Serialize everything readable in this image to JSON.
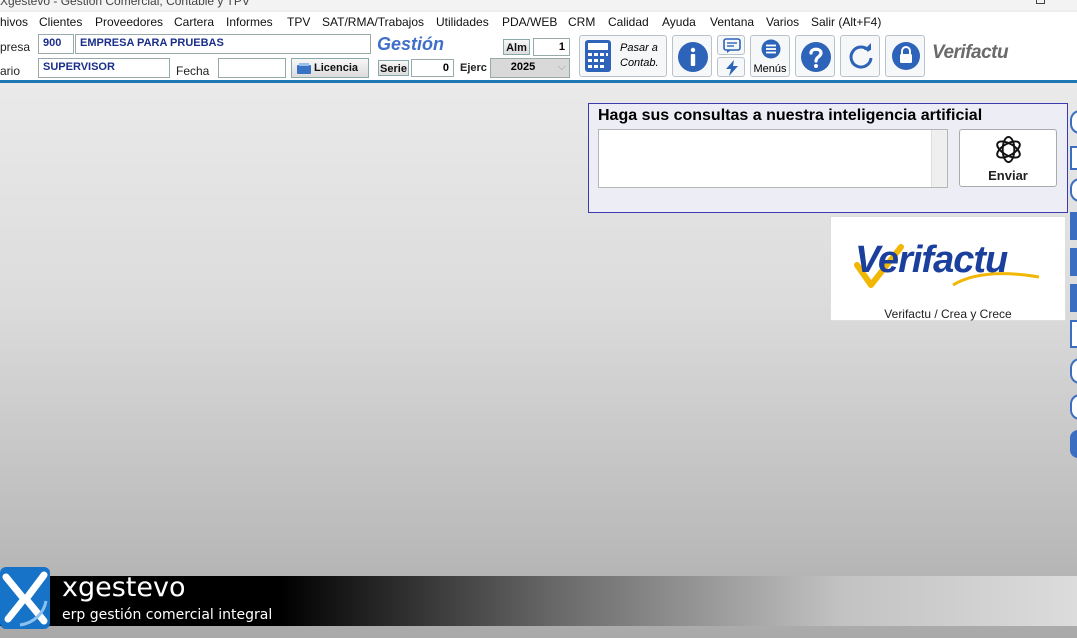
{
  "window": {
    "title": "Xgestevo - Gestión Comercial, Contable y TPV"
  },
  "menu": {
    "items": [
      "hivos",
      "Clientes",
      "Proveedores",
      "Cartera",
      "Informes",
      "TPV",
      "SAT/RMA/Trabajos",
      "Utilidades",
      "PDA/WEB",
      "CRM",
      "Calidad",
      "Ayuda",
      "Ventana",
      "Varios",
      "Salir (Alt+F4)"
    ]
  },
  "toolbar": {
    "empresa_label": "presa",
    "empresa_code": "900",
    "empresa_name": "EMPRESA PARA PRUEBAS",
    "usuario_label": "ario",
    "usuario_name": "SUPERVISOR",
    "fecha_label": "Fecha",
    "fecha_value": "",
    "licencia_label": "Licencia",
    "gestion_label": "Gestión",
    "alm_label": "Alm",
    "alm_value": "1",
    "serie_label": "Serie",
    "serie_value": "0",
    "ejerc_label": "Ejerc",
    "ejerc_value": "2025",
    "pasar_label_1": "Pasar a",
    "pasar_label_2": "Contab.",
    "menus_label": "Menús",
    "verifactu_small": "Verifactu"
  },
  "ai": {
    "title": "Haga sus consultas a nuestra inteligencia artificial",
    "input_value": "",
    "send_label": "Enviar"
  },
  "verifactu_panel": {
    "logo_text": "Verifactu",
    "caption": "Verifactu / Crea y Crece"
  },
  "branding": {
    "name": "xgestevo",
    "tagline": "erp gestión comercial integral"
  },
  "colors": {
    "accent": "#1e78b4",
    "brand_blue": "#1b3f9c",
    "gestion_blue": "#3f6fc8"
  }
}
